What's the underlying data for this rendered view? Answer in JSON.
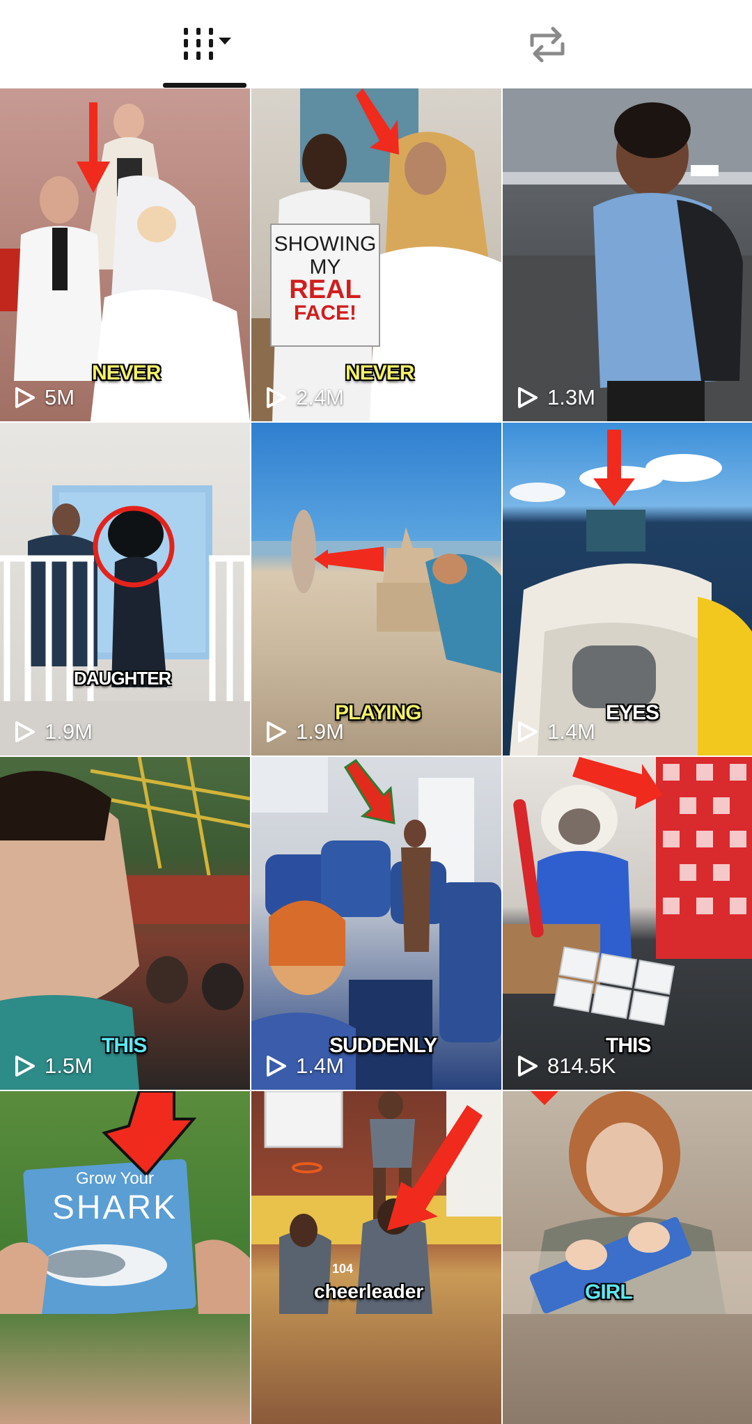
{
  "tabs": {
    "videos_icon": "grid-icon",
    "dropdown_icon": "caret-down-icon",
    "reposts_icon": "repost-icon",
    "selected": "videos"
  },
  "colors": {
    "indicator": "#161616",
    "views_text": "#ffffff",
    "arrow_red": "#f02a1d"
  },
  "videos": [
    {
      "views": "5M",
      "caption": "NEVER"
    },
    {
      "views": "2.4M",
      "caption": "NEVER",
      "sign": [
        "SHOWING",
        "MY",
        "REAL",
        "FACE!"
      ]
    },
    {
      "views": "1.3M",
      "caption": ""
    },
    {
      "views": "1.9M",
      "caption": "DAUGHTER"
    },
    {
      "views": "1.9M",
      "caption": "PLAYING"
    },
    {
      "views": "1.4M",
      "caption": "EYES"
    },
    {
      "views": "1.5M",
      "caption": "THIS"
    },
    {
      "views": "1.4M",
      "caption": "SUDDENLY"
    },
    {
      "views": "814.5K",
      "caption": "THIS"
    },
    {
      "views": "",
      "caption": "",
      "book_text": [
        "Grow Your",
        "SHARK"
      ]
    },
    {
      "views": "",
      "caption": "cheerleader",
      "jersey": "104"
    },
    {
      "views": "",
      "caption": "GIRL"
    }
  ]
}
